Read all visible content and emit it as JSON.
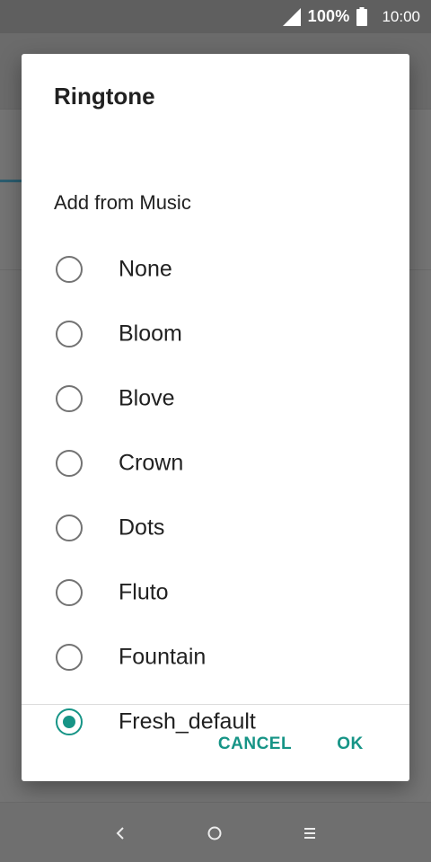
{
  "status_bar": {
    "battery_percent": "100%",
    "time": "10:00",
    "icons": [
      "signal-icon",
      "battery-icon"
    ]
  },
  "dialog": {
    "title": "Ringtone",
    "add_from_music": "Add from Music",
    "options": [
      {
        "label": "None",
        "checked": false
      },
      {
        "label": "Bloom",
        "checked": false
      },
      {
        "label": "Blove",
        "checked": false
      },
      {
        "label": "Crown",
        "checked": false
      },
      {
        "label": "Dots",
        "checked": false
      },
      {
        "label": "Fluto",
        "checked": false
      },
      {
        "label": "Fountain",
        "checked": false
      },
      {
        "label": "Fresh_default",
        "checked": true
      }
    ],
    "cancel_label": "CANCEL",
    "ok_label": "OK"
  },
  "nav_bar": {
    "icons": [
      "back-icon",
      "home-icon",
      "menu-icon"
    ]
  },
  "colors": {
    "accent": "#169486",
    "scrim": "#747474",
    "dialog_bg": "#ffffff",
    "text_primary": "#212121",
    "radio_unchecked": "#737373"
  }
}
